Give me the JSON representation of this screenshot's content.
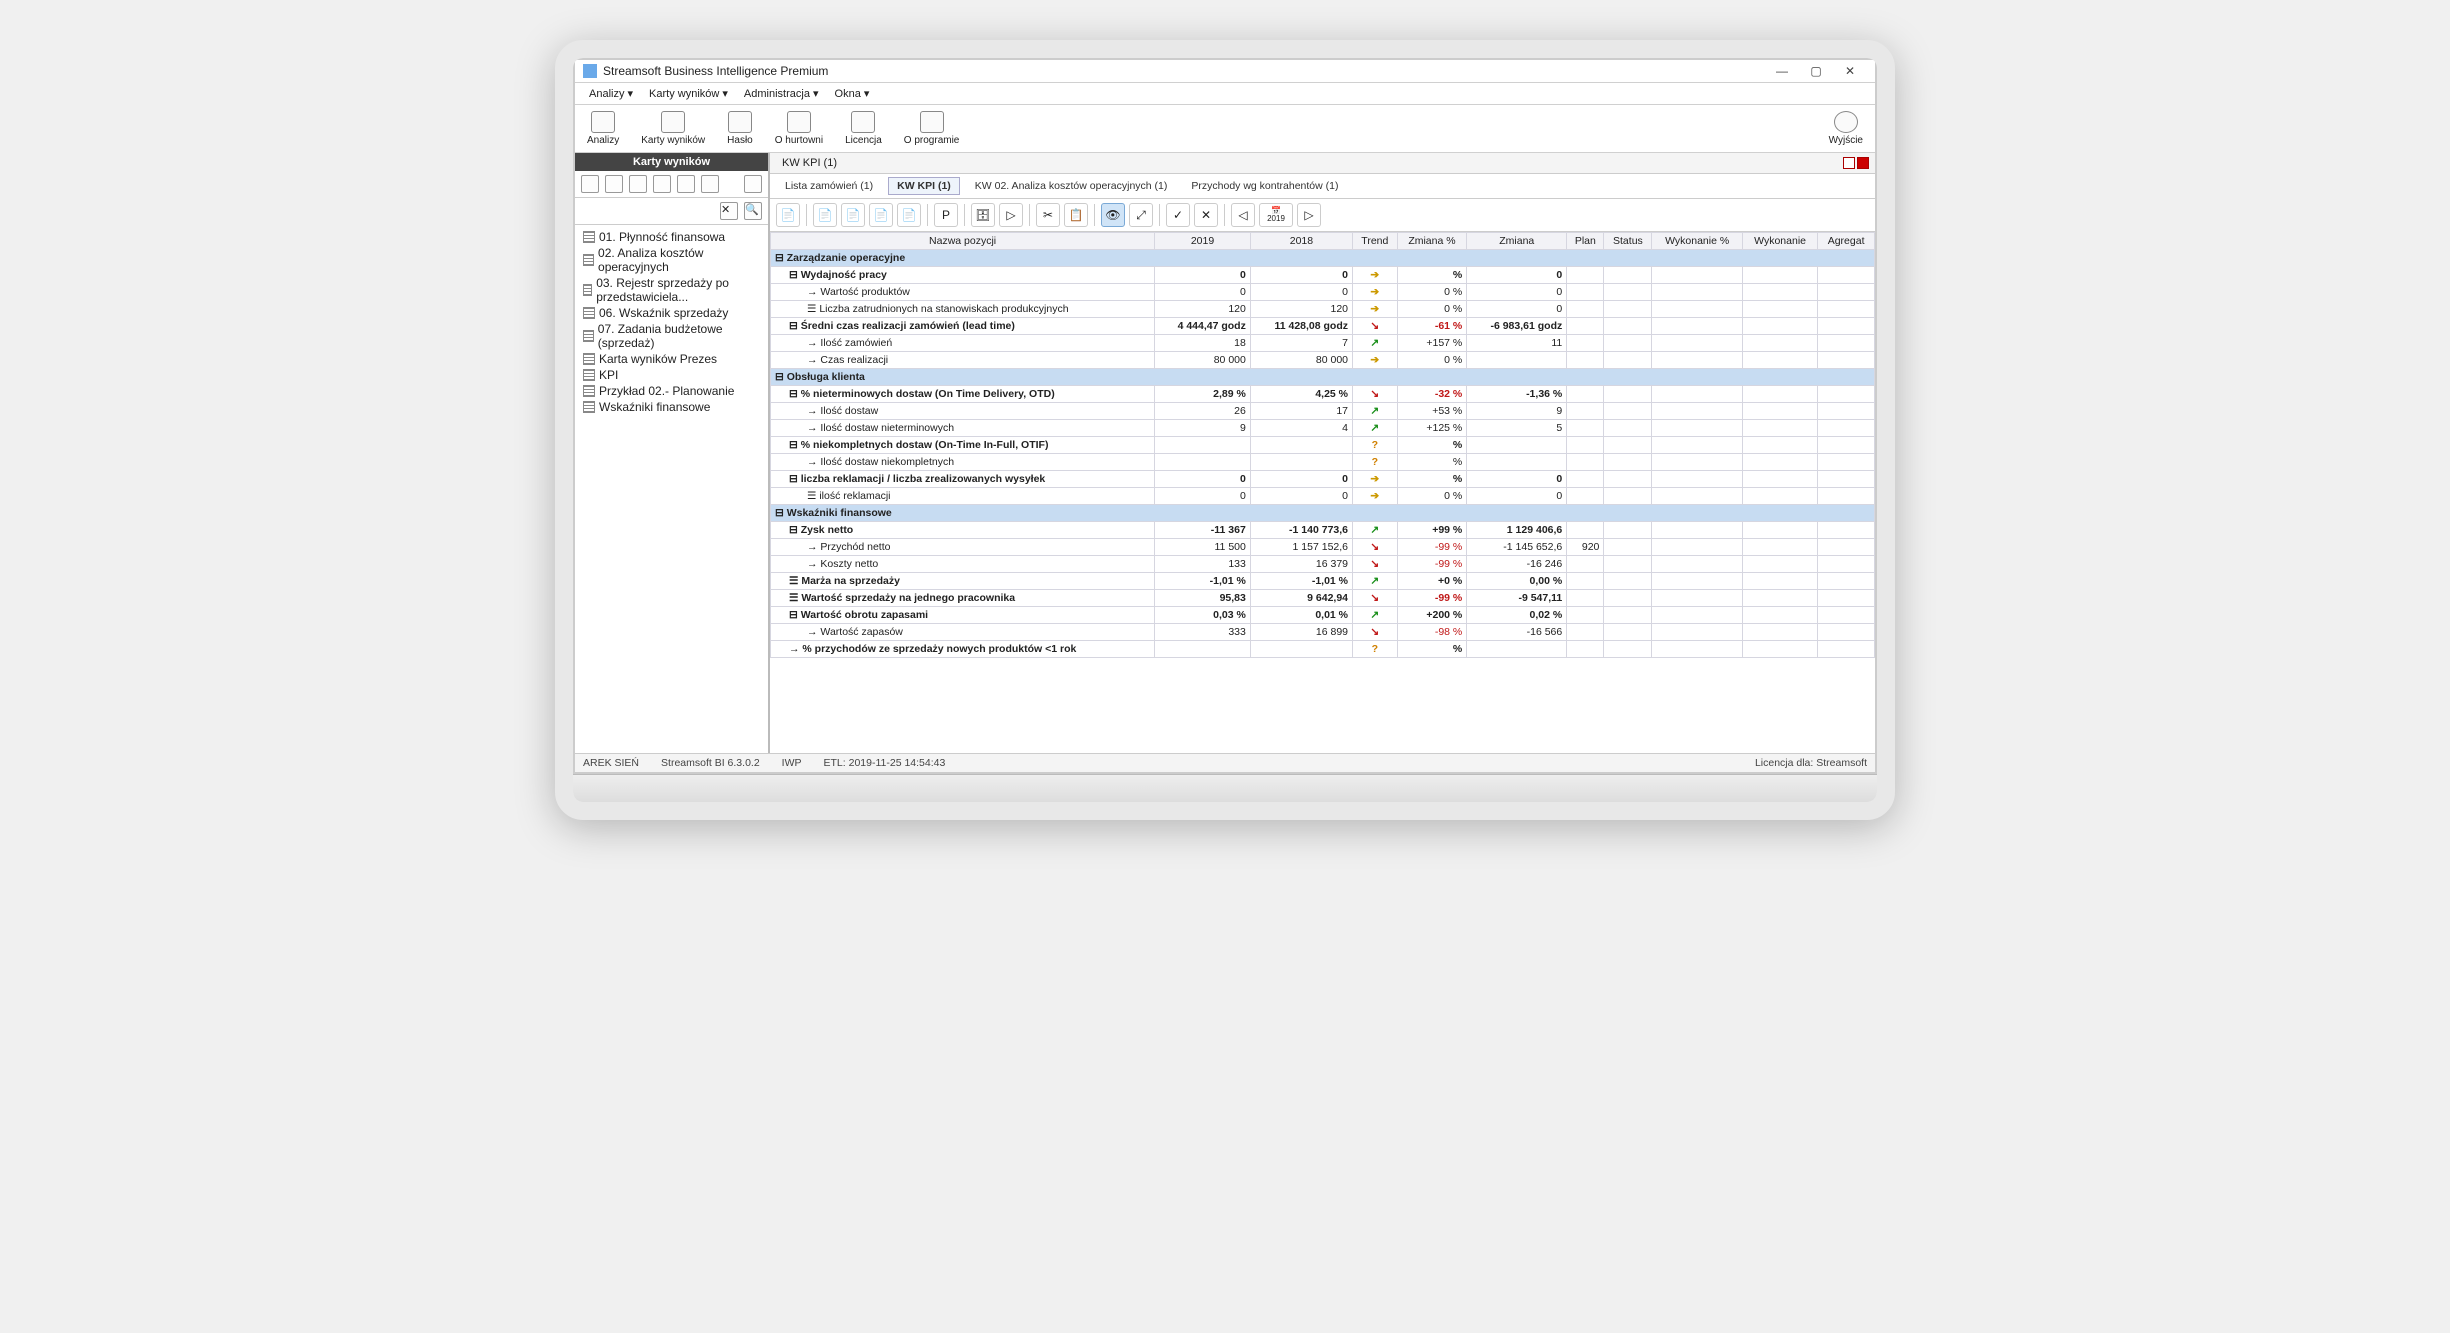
{
  "window": {
    "title": "Streamsoft Business Intelligence Premium"
  },
  "menu": {
    "items": [
      "Analizy ▾",
      "Karty wyników ▾",
      "Administracja ▾",
      "Okna ▾"
    ]
  },
  "ribbon": {
    "items": [
      "Analizy",
      "Karty wyników",
      "Hasło",
      "O hurtowni",
      "Licencja",
      "O programie"
    ],
    "exit": "Wyjście"
  },
  "sidebar": {
    "header": "Karty wyników",
    "items": [
      "01. Płynność finansowa",
      "02. Analiza kosztów operacyjnych",
      "03. Rejestr sprzedaży po przedstawiciela...",
      "06. Wskaźnik sprzedaży",
      "07. Zadania budżetowe (sprzedaż)",
      "Karta wyników Prezes",
      "KPI",
      "Przykład 02.- Planowanie",
      "Wskaźniki finansowe"
    ]
  },
  "module_tab": "KW KPI (1)",
  "doc_tabs": {
    "items": [
      {
        "label": "Lista zamówień (1)",
        "active": false
      },
      {
        "label": "KW KPI (1)",
        "active": true
      },
      {
        "label": "KW 02. Analiza kosztów operacyjnych (1)",
        "active": false
      },
      {
        "label": "Przychody wg kontrahentów (1)",
        "active": false
      }
    ]
  },
  "year_nav": "2019",
  "columns": [
    "Nazwa pozycji",
    "2019",
    "2018",
    "Trend",
    "Zmiana %",
    "Zmiana",
    "Plan",
    "Status",
    "Wykonanie %",
    "Wykonanie",
    "Agregat"
  ],
  "rows": [
    {
      "type": "section",
      "name": "Zarządzanie operacyjne"
    },
    {
      "type": "bold",
      "indent": 1,
      "icon": "minus",
      "name": "Wydajność pracy",
      "c2019": "0",
      "c2018": "0",
      "trend": "eq",
      "zmpct": "%",
      "zm": "0"
    },
    {
      "indent": 2,
      "icon": "arrow",
      "name": "Wartość produktów",
      "c2019": "0",
      "c2018": "0",
      "trend": "eq",
      "zmpct": "0 %",
      "zm": "0"
    },
    {
      "indent": 2,
      "icon": "kpi",
      "name": "Liczba zatrudnionych na stanowiskach produkcyjnych",
      "c2019": "120",
      "c2018": "120",
      "trend": "eq",
      "zmpct": "0 %",
      "zm": "0"
    },
    {
      "type": "bold",
      "indent": 1,
      "icon": "minus",
      "name": "Średni czas realizacji zamówień (lead time)",
      "c2019": "4 444,47 godz",
      "c2018": "11 428,08 godz",
      "trend": "dn",
      "zmpct": "-61 %",
      "zm": "-6 983,61 godz",
      "zmpct_cls": "neg"
    },
    {
      "indent": 2,
      "icon": "arrow",
      "name": "Ilość zamówień",
      "c2019": "18",
      "c2018": "7",
      "trend": "up",
      "zmpct": "+157 %",
      "zm": "11"
    },
    {
      "indent": 2,
      "icon": "arrow",
      "name": "Czas realizacji",
      "c2019": "80 000",
      "c2018": "80 000",
      "trend": "eq",
      "zmpct": "0 %",
      "zm": ""
    },
    {
      "type": "section",
      "name": "Obsługa klienta"
    },
    {
      "type": "bold",
      "indent": 1,
      "icon": "minus",
      "name": "% nieterminowych dostaw (On Time Delivery, OTD)",
      "c2019": "2,89 %",
      "c2018": "4,25 %",
      "trend": "dn",
      "zmpct": "-32 %",
      "zm": "-1,36 %",
      "zmpct_cls": "neg"
    },
    {
      "indent": 2,
      "icon": "arrow",
      "name": "Ilość dostaw",
      "c2019": "26",
      "c2018": "17",
      "trend": "up",
      "zmpct": "+53 %",
      "zm": "9"
    },
    {
      "indent": 2,
      "icon": "arrow",
      "name": "Ilość dostaw nieterminowych",
      "c2019": "9",
      "c2018": "4",
      "trend": "up",
      "zmpct": "+125 %",
      "zm": "5"
    },
    {
      "type": "bold",
      "indent": 1,
      "icon": "minus",
      "name": "% niekompletnych dostaw (On-Time In-Full, OTIF)",
      "trend": "q",
      "zmpct": "%"
    },
    {
      "indent": 2,
      "icon": "arrow",
      "name": "Ilość dostaw niekompletnych",
      "trend": "q",
      "zmpct": "%"
    },
    {
      "type": "bold",
      "indent": 1,
      "icon": "minus",
      "name": "liczba reklamacji / liczba zrealizowanych wysyłek",
      "c2019": "0",
      "c2018": "0",
      "trend": "eq",
      "zmpct": "%",
      "zm": "0"
    },
    {
      "indent": 2,
      "icon": "kpi",
      "name": "ilość reklamacji",
      "c2019": "0",
      "c2018": "0",
      "trend": "eq",
      "zmpct": "0 %",
      "zm": "0"
    },
    {
      "type": "section",
      "name": "Wskaźniki finansowe"
    },
    {
      "type": "bold",
      "indent": 1,
      "icon": "minus",
      "name": "Zysk netto",
      "c2019": "-11 367",
      "c2018": "-1 140 773,6",
      "trend": "up",
      "zmpct": "+99 %",
      "zm": "1 129 406,6"
    },
    {
      "indent": 2,
      "icon": "arrow",
      "name": "Przychód netto",
      "c2019": "11 500",
      "c2018": "1 157 152,6",
      "trend": "dn",
      "zmpct": "-99 %",
      "zm": "-1 145 652,6",
      "plan": "920",
      "zmpct_cls": "neg"
    },
    {
      "indent": 2,
      "icon": "arrow",
      "name": "Koszty netto",
      "c2019": "133",
      "c2018": "16 379",
      "trend": "dn",
      "zmpct": "-99 %",
      "zm": "-16 246",
      "zmpct_cls": "neg"
    },
    {
      "type": "bold",
      "indent": 1,
      "icon": "kpi",
      "name": "Marża na sprzedaży",
      "c2019": "-1,01 %",
      "c2018": "-1,01 %",
      "trend": "up",
      "zmpct": "+0 %",
      "zm": "0,00 %"
    },
    {
      "type": "bold",
      "indent": 1,
      "icon": "kpi",
      "name": "Wartość sprzedaży na jednego pracownika",
      "c2019": "95,83",
      "c2018": "9 642,94",
      "trend": "dn",
      "zmpct": "-99 %",
      "zm": "-9 547,11",
      "zmpct_cls": "neg"
    },
    {
      "type": "bold",
      "indent": 1,
      "icon": "minus",
      "name": "Wartość obrotu zapasami",
      "c2019": "0,03 %",
      "c2018": "0,01 %",
      "trend": "up",
      "zmpct": "+200 %",
      "zm": "0,02 %"
    },
    {
      "indent": 2,
      "icon": "arrow",
      "name": "Wartość zapasów",
      "c2019": "333",
      "c2018": "16 899",
      "trend": "dn",
      "zmpct": "-98 %",
      "zm": "-16 566",
      "zmpct_cls": "neg"
    },
    {
      "type": "bold",
      "indent": 1,
      "icon": "arrow",
      "name": "% przychodów ze sprzedaży nowych produktów <1 rok",
      "trend": "q",
      "zmpct": "%"
    }
  ],
  "status": {
    "user": "AREK SIEŃ",
    "app": "Streamsoft BI 6.3.0.2",
    "iwp": "IWP",
    "etl": "ETL: 2019-11-25 14:54:43",
    "license": "Licencja dla: Streamsoft"
  }
}
